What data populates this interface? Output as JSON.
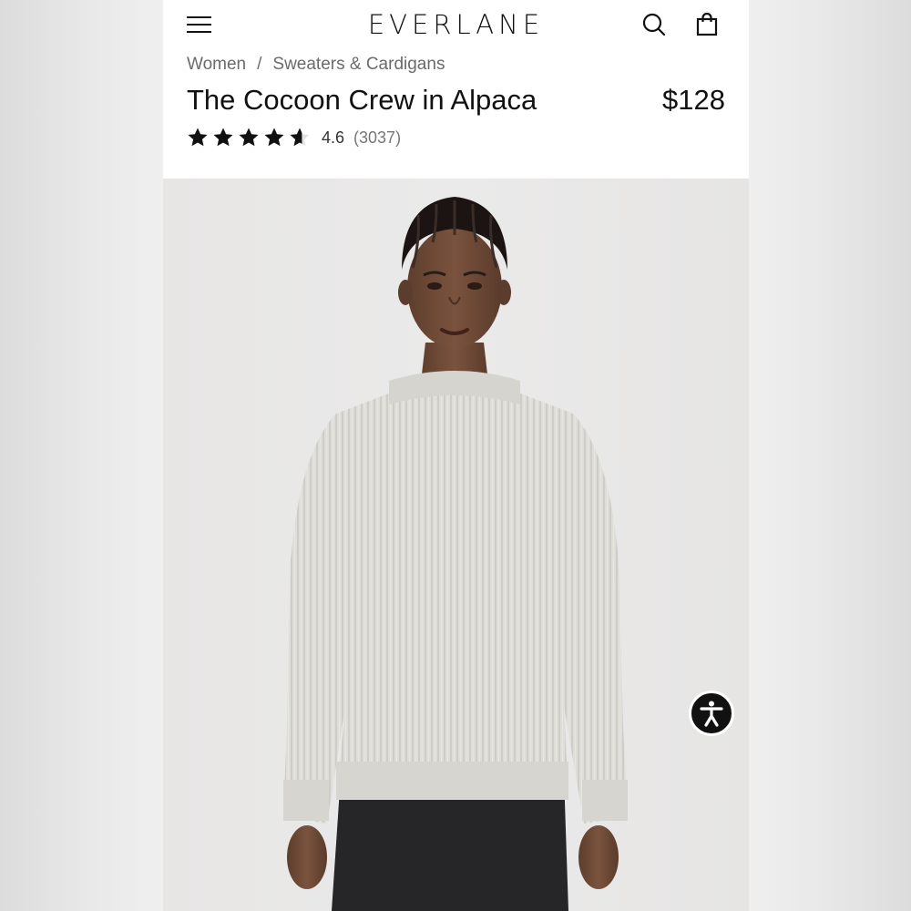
{
  "header": {
    "brand": "EVERLANE",
    "menu_icon": "hamburger-menu-icon",
    "search_icon": "search-icon",
    "bag_icon": "shopping-bag-icon"
  },
  "breadcrumb": {
    "items": [
      "Women",
      "Sweaters & Cardigans"
    ],
    "separator": "/"
  },
  "product": {
    "name": "The Cocoon Crew in Alpaca",
    "price": "$128",
    "rating": "4.6",
    "rating_stars": 4.6,
    "review_count": "(3037)"
  },
  "image": {
    "alt": "Model wearing The Cocoon Crew in Alpaca sweater in light heather grey"
  },
  "accessibility": {
    "icon": "accessibility-icon"
  },
  "colors": {
    "text": "#111111",
    "muted": "#6b6b6b",
    "sweater": "#dedcd6",
    "jeans": "#2a2a2c",
    "skin": "#6e4a36"
  }
}
